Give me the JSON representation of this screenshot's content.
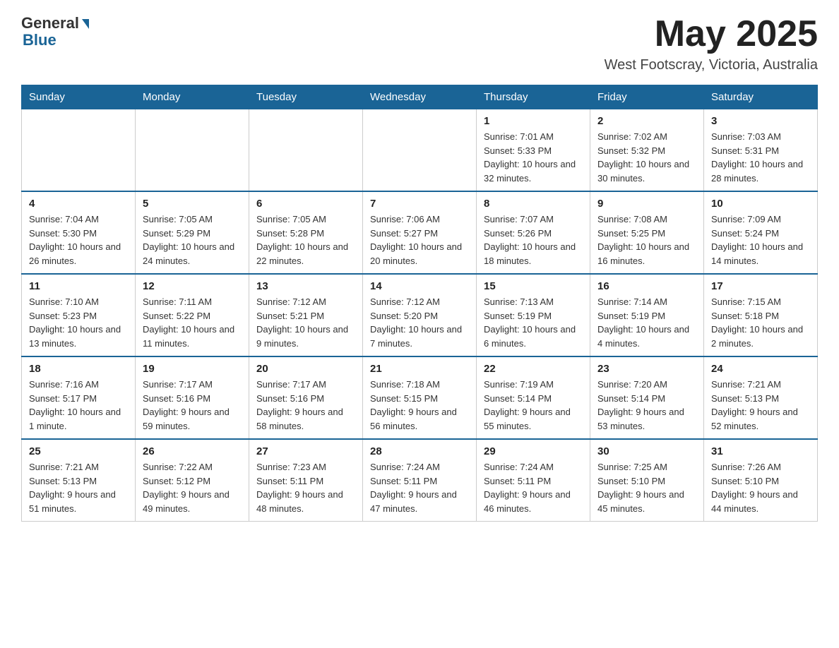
{
  "header": {
    "logo_general": "General",
    "logo_blue": "Blue",
    "month_title": "May 2025",
    "location": "West Footscray, Victoria, Australia"
  },
  "weekdays": [
    "Sunday",
    "Monday",
    "Tuesday",
    "Wednesday",
    "Thursday",
    "Friday",
    "Saturday"
  ],
  "weeks": [
    [
      {
        "day": "",
        "sunrise": "",
        "sunset": "",
        "daylight": ""
      },
      {
        "day": "",
        "sunrise": "",
        "sunset": "",
        "daylight": ""
      },
      {
        "day": "",
        "sunrise": "",
        "sunset": "",
        "daylight": ""
      },
      {
        "day": "",
        "sunrise": "",
        "sunset": "",
        "daylight": ""
      },
      {
        "day": "1",
        "sunrise": "Sunrise: 7:01 AM",
        "sunset": "Sunset: 5:33 PM",
        "daylight": "Daylight: 10 hours and 32 minutes."
      },
      {
        "day": "2",
        "sunrise": "Sunrise: 7:02 AM",
        "sunset": "Sunset: 5:32 PM",
        "daylight": "Daylight: 10 hours and 30 minutes."
      },
      {
        "day": "3",
        "sunrise": "Sunrise: 7:03 AM",
        "sunset": "Sunset: 5:31 PM",
        "daylight": "Daylight: 10 hours and 28 minutes."
      }
    ],
    [
      {
        "day": "4",
        "sunrise": "Sunrise: 7:04 AM",
        "sunset": "Sunset: 5:30 PM",
        "daylight": "Daylight: 10 hours and 26 minutes."
      },
      {
        "day": "5",
        "sunrise": "Sunrise: 7:05 AM",
        "sunset": "Sunset: 5:29 PM",
        "daylight": "Daylight: 10 hours and 24 minutes."
      },
      {
        "day": "6",
        "sunrise": "Sunrise: 7:05 AM",
        "sunset": "Sunset: 5:28 PM",
        "daylight": "Daylight: 10 hours and 22 minutes."
      },
      {
        "day": "7",
        "sunrise": "Sunrise: 7:06 AM",
        "sunset": "Sunset: 5:27 PM",
        "daylight": "Daylight: 10 hours and 20 minutes."
      },
      {
        "day": "8",
        "sunrise": "Sunrise: 7:07 AM",
        "sunset": "Sunset: 5:26 PM",
        "daylight": "Daylight: 10 hours and 18 minutes."
      },
      {
        "day": "9",
        "sunrise": "Sunrise: 7:08 AM",
        "sunset": "Sunset: 5:25 PM",
        "daylight": "Daylight: 10 hours and 16 minutes."
      },
      {
        "day": "10",
        "sunrise": "Sunrise: 7:09 AM",
        "sunset": "Sunset: 5:24 PM",
        "daylight": "Daylight: 10 hours and 14 minutes."
      }
    ],
    [
      {
        "day": "11",
        "sunrise": "Sunrise: 7:10 AM",
        "sunset": "Sunset: 5:23 PM",
        "daylight": "Daylight: 10 hours and 13 minutes."
      },
      {
        "day": "12",
        "sunrise": "Sunrise: 7:11 AM",
        "sunset": "Sunset: 5:22 PM",
        "daylight": "Daylight: 10 hours and 11 minutes."
      },
      {
        "day": "13",
        "sunrise": "Sunrise: 7:12 AM",
        "sunset": "Sunset: 5:21 PM",
        "daylight": "Daylight: 10 hours and 9 minutes."
      },
      {
        "day": "14",
        "sunrise": "Sunrise: 7:12 AM",
        "sunset": "Sunset: 5:20 PM",
        "daylight": "Daylight: 10 hours and 7 minutes."
      },
      {
        "day": "15",
        "sunrise": "Sunrise: 7:13 AM",
        "sunset": "Sunset: 5:19 PM",
        "daylight": "Daylight: 10 hours and 6 minutes."
      },
      {
        "day": "16",
        "sunrise": "Sunrise: 7:14 AM",
        "sunset": "Sunset: 5:19 PM",
        "daylight": "Daylight: 10 hours and 4 minutes."
      },
      {
        "day": "17",
        "sunrise": "Sunrise: 7:15 AM",
        "sunset": "Sunset: 5:18 PM",
        "daylight": "Daylight: 10 hours and 2 minutes."
      }
    ],
    [
      {
        "day": "18",
        "sunrise": "Sunrise: 7:16 AM",
        "sunset": "Sunset: 5:17 PM",
        "daylight": "Daylight: 10 hours and 1 minute."
      },
      {
        "day": "19",
        "sunrise": "Sunrise: 7:17 AM",
        "sunset": "Sunset: 5:16 PM",
        "daylight": "Daylight: 9 hours and 59 minutes."
      },
      {
        "day": "20",
        "sunrise": "Sunrise: 7:17 AM",
        "sunset": "Sunset: 5:16 PM",
        "daylight": "Daylight: 9 hours and 58 minutes."
      },
      {
        "day": "21",
        "sunrise": "Sunrise: 7:18 AM",
        "sunset": "Sunset: 5:15 PM",
        "daylight": "Daylight: 9 hours and 56 minutes."
      },
      {
        "day": "22",
        "sunrise": "Sunrise: 7:19 AM",
        "sunset": "Sunset: 5:14 PM",
        "daylight": "Daylight: 9 hours and 55 minutes."
      },
      {
        "day": "23",
        "sunrise": "Sunrise: 7:20 AM",
        "sunset": "Sunset: 5:14 PM",
        "daylight": "Daylight: 9 hours and 53 minutes."
      },
      {
        "day": "24",
        "sunrise": "Sunrise: 7:21 AM",
        "sunset": "Sunset: 5:13 PM",
        "daylight": "Daylight: 9 hours and 52 minutes."
      }
    ],
    [
      {
        "day": "25",
        "sunrise": "Sunrise: 7:21 AM",
        "sunset": "Sunset: 5:13 PM",
        "daylight": "Daylight: 9 hours and 51 minutes."
      },
      {
        "day": "26",
        "sunrise": "Sunrise: 7:22 AM",
        "sunset": "Sunset: 5:12 PM",
        "daylight": "Daylight: 9 hours and 49 minutes."
      },
      {
        "day": "27",
        "sunrise": "Sunrise: 7:23 AM",
        "sunset": "Sunset: 5:11 PM",
        "daylight": "Daylight: 9 hours and 48 minutes."
      },
      {
        "day": "28",
        "sunrise": "Sunrise: 7:24 AM",
        "sunset": "Sunset: 5:11 PM",
        "daylight": "Daylight: 9 hours and 47 minutes."
      },
      {
        "day": "29",
        "sunrise": "Sunrise: 7:24 AM",
        "sunset": "Sunset: 5:11 PM",
        "daylight": "Daylight: 9 hours and 46 minutes."
      },
      {
        "day": "30",
        "sunrise": "Sunrise: 7:25 AM",
        "sunset": "Sunset: 5:10 PM",
        "daylight": "Daylight: 9 hours and 45 minutes."
      },
      {
        "day": "31",
        "sunrise": "Sunrise: 7:26 AM",
        "sunset": "Sunset: 5:10 PM",
        "daylight": "Daylight: 9 hours and 44 minutes."
      }
    ]
  ]
}
